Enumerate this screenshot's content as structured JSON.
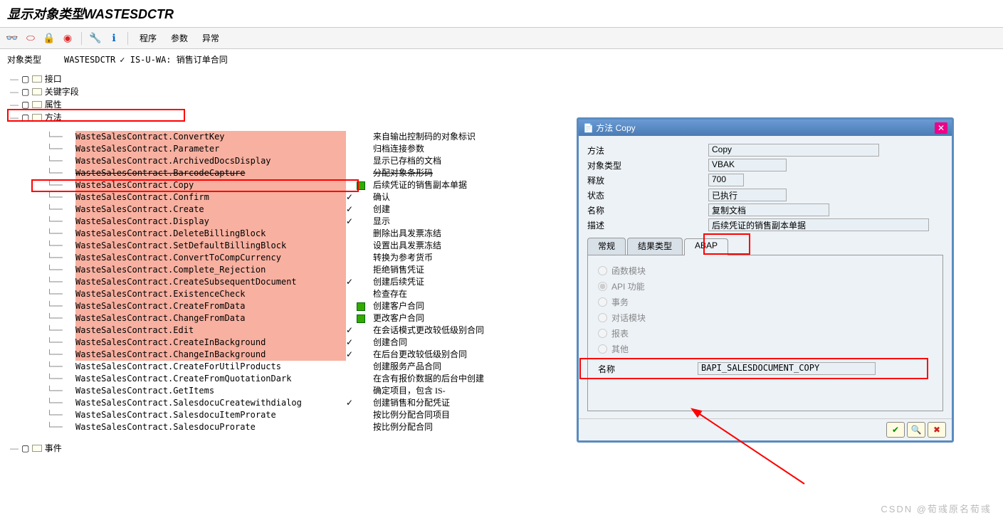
{
  "title": "显示对象类型WASTESDCTR",
  "menus": [
    "程序",
    "参数",
    "异常"
  ],
  "header": {
    "label": "对象类型",
    "code": "WASTESDCTR",
    "status": "✓ IS-U-WA: 销售订单合同"
  },
  "tree": {
    "nodes": [
      {
        "label": "接口",
        "indent": 1
      },
      {
        "label": "关键字段",
        "indent": 1
      },
      {
        "label": "属性",
        "indent": 1
      },
      {
        "label": "方法",
        "indent": 1,
        "highlight": true
      }
    ]
  },
  "methods": [
    {
      "name": "WasteSalesContract.ConvertKey",
      "pink": true,
      "desc": "来自输出控制码的对象标识"
    },
    {
      "name": "WasteSalesContract.Parameter",
      "pink": true,
      "desc": "归档连接参数"
    },
    {
      "name": "WasteSalesContract.ArchivedDocsDisplay",
      "pink": true,
      "desc": "显示已存档的文档"
    },
    {
      "name": "WasteSalesContract.BarcodeCapture",
      "pink": true,
      "desc": "分配对象条形码",
      "strike": true
    },
    {
      "name": "WasteSalesContract.Copy",
      "pink": true,
      "desc": "后续凭证的销售副本单据",
      "green": true,
      "highlight": true
    },
    {
      "name": "WasteSalesContract.Confirm",
      "pink": true,
      "check": true,
      "desc": "确认"
    },
    {
      "name": "WasteSalesContract.Create",
      "pink": true,
      "check": true,
      "desc": "创建"
    },
    {
      "name": "WasteSalesContract.Display",
      "pink": true,
      "check": true,
      "desc": "显示"
    },
    {
      "name": "WasteSalesContract.DeleteBillingBlock",
      "pink": true,
      "desc": "删除出具发票冻结"
    },
    {
      "name": "WasteSalesContract.SetDefaultBillingBlock",
      "pink": true,
      "desc": "设置出具发票冻结"
    },
    {
      "name": "WasteSalesContract.ConvertToCompCurrency",
      "pink": true,
      "desc": "转换为参考货币"
    },
    {
      "name": "WasteSalesContract.Complete_Rejection",
      "pink": true,
      "desc": "拒绝销售凭证"
    },
    {
      "name": "WasteSalesContract.CreateSubsequentDocument",
      "pink": true,
      "check": true,
      "desc": "创建后续凭证"
    },
    {
      "name": "WasteSalesContract.ExistenceCheck",
      "pink": true,
      "desc": "检查存在"
    },
    {
      "name": "WasteSalesContract.CreateFromData",
      "pink": true,
      "desc": "创建客户合同",
      "green": true
    },
    {
      "name": "WasteSalesContract.ChangeFromData",
      "pink": true,
      "desc": "更改客户合同",
      "green": true
    },
    {
      "name": "WasteSalesContract.Edit",
      "pink": true,
      "check": true,
      "desc": "在会话模式更改较低级别合同"
    },
    {
      "name": "WasteSalesContract.CreateInBackground",
      "pink": true,
      "check": true,
      "desc": "创建合同"
    },
    {
      "name": "WasteSalesContract.ChangeInBackground",
      "pink": true,
      "check": true,
      "desc": "在后台更改较低级别合同"
    },
    {
      "name": "WasteSalesContract.CreateForUtilProducts",
      "pink": false,
      "desc": "创建服务产品合同"
    },
    {
      "name": "WasteSalesContract.CreateFromQuotationDark",
      "pink": false,
      "desc": "在含有报价数据的后台中创建"
    },
    {
      "name": "WasteSalesContract.GetItems",
      "pink": false,
      "desc": "确定项目，包含 IS-"
    },
    {
      "name": "WasteSalesContract.SalesdocuCreatewithdialog",
      "pink": false,
      "check": true,
      "desc": "创建销售和分配凭证"
    },
    {
      "name": "WasteSalesContract.SalesdocuItemProrate",
      "pink": false,
      "desc": "按比例分配合同项目"
    },
    {
      "name": "WasteSalesContract.SalesdocuProrate",
      "pink": false,
      "desc": "按比例分配合同"
    }
  ],
  "events_label": "事件",
  "dialog": {
    "title": "方法 Copy",
    "fields": {
      "method_l": "方法",
      "method_v": "Copy",
      "objtype_l": "对象类型",
      "objtype_v": "VBAK",
      "release_l": "释放",
      "release_v": "700",
      "status_l": "状态",
      "status_v": "已执行",
      "name_l": "名称",
      "name_v": "复制文档",
      "desc_l": "描述",
      "desc_v": "后续凭证的销售副本单据"
    },
    "tabs": [
      "常规",
      "结果类型",
      "ABAP"
    ],
    "radios": [
      "函数模块",
      "API 功能",
      "事务",
      "对话模块",
      "报表",
      "其他"
    ],
    "radio_selected": 1,
    "name_label": "名称",
    "name_value": "BAPI_SALESDOCUMENT_COPY"
  },
  "watermark": "CSDN @荀彧原名荀彧"
}
